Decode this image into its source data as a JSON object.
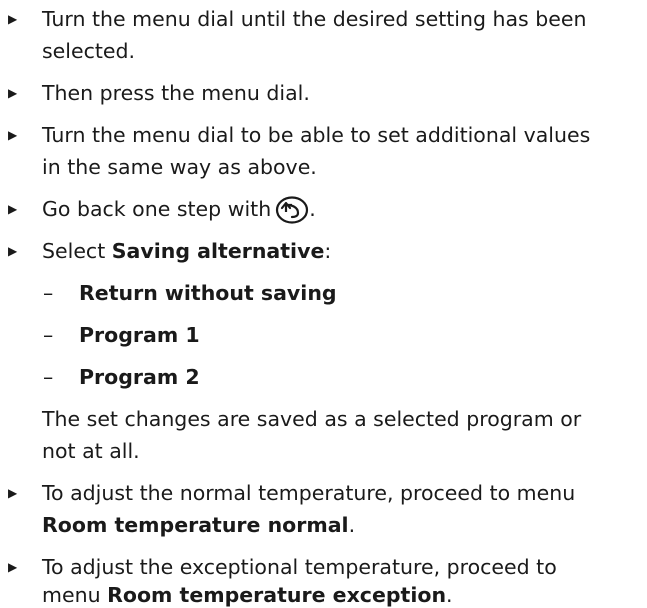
{
  "steps": [
    {
      "line1": "Turn the menu dial until the desired setting has been",
      "line2": "selected."
    },
    {
      "line1": "Then press the menu dial."
    },
    {
      "line1": "Turn the menu dial to be able to set additional values",
      "line2": "in the same way as above."
    },
    {
      "prefix": "Go back one step with",
      "suffix": "."
    },
    {
      "prefix": "Select ",
      "bold": "Saving alternative",
      "suffix": ":"
    }
  ],
  "options": [
    "Return without saving",
    "Program 1",
    "Program 2"
  ],
  "note": {
    "line1": "The set changes are saved as a selected program or",
    "line2": "not at all."
  },
  "normal_step": {
    "line1": "To adjust the normal temperature, proceed to menu",
    "bold": "Room temperature normal",
    "suffix": "."
  },
  "exception_step": {
    "line1": "To adjust the exceptional temperature, proceed to",
    "prefix": "menu ",
    "bold": "Room temperature exception",
    "suffix": "."
  },
  "icons": {
    "bullet": "triangle-right",
    "back": "back-arrow-circle"
  }
}
